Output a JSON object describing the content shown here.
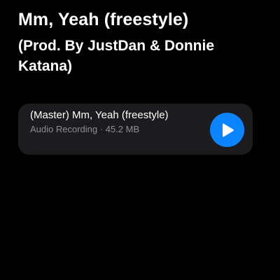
{
  "header": {
    "title": "Mm, Yeah (freestyle)",
    "subtitle": "(Prod. By JustDan & Donnie Katana)"
  },
  "attachment": {
    "title": "(Master) Mm, Yeah (freestyle)",
    "type": "Audio Recording",
    "separator": "·",
    "size": "45.2 MB",
    "play_icon": "play-icon",
    "accent_color": "#0a84ff"
  }
}
